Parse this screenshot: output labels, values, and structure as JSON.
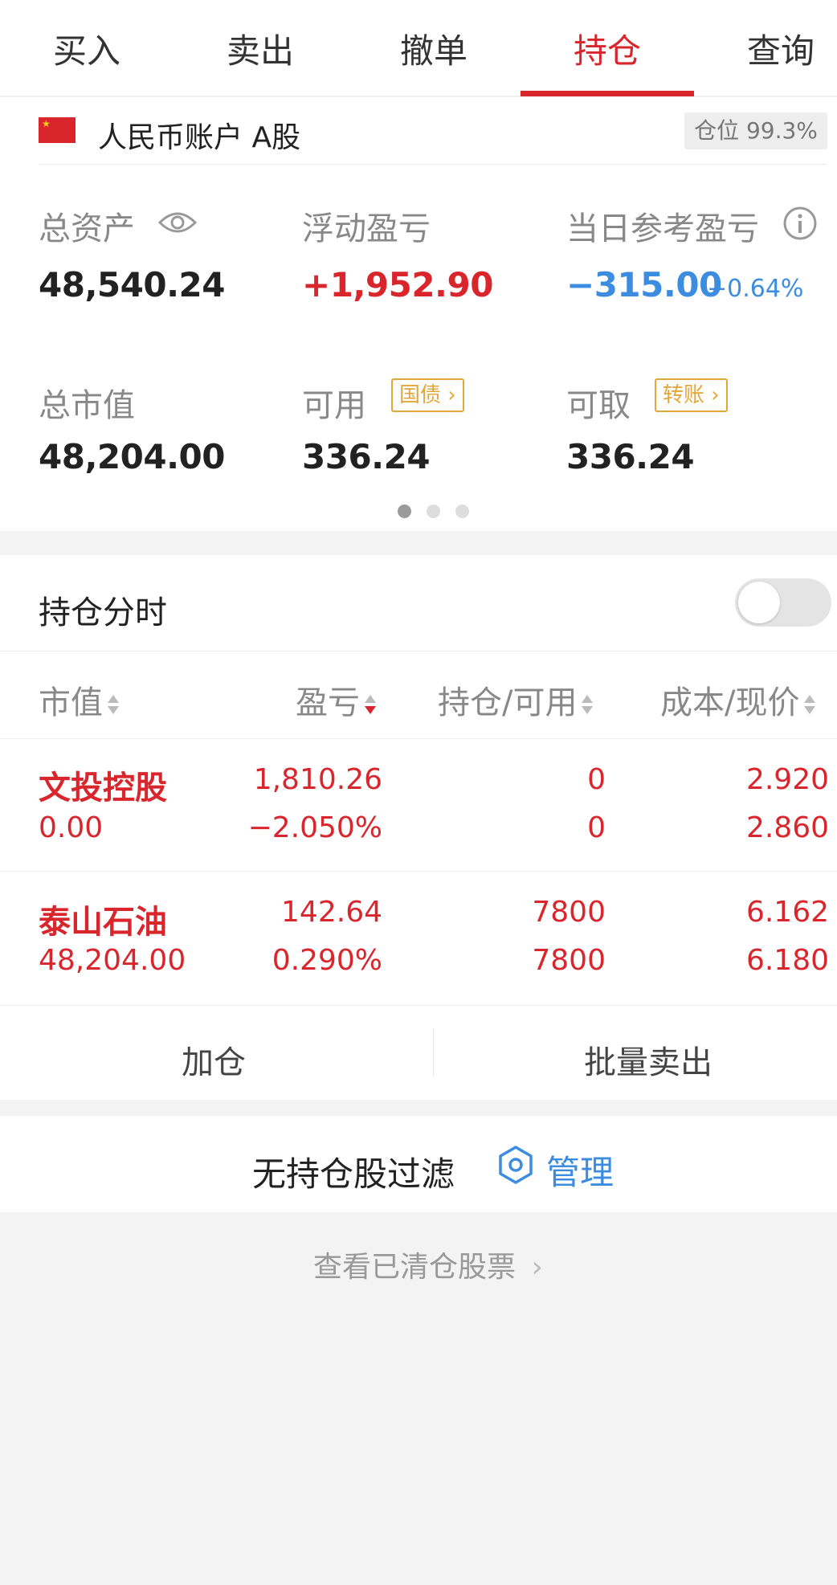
{
  "tabs": [
    {
      "label": "买入"
    },
    {
      "label": "卖出"
    },
    {
      "label": "撤单"
    },
    {
      "label": "持仓",
      "active": true
    },
    {
      "label": "查询"
    }
  ],
  "account": {
    "name": "人民币账户 A股",
    "position_badge": "仓位 99.3%"
  },
  "stats": {
    "total_assets": {
      "label": "总资产",
      "value": "48,540.24"
    },
    "floating_pl": {
      "label": "浮动盈亏",
      "value": "+1,952.90"
    },
    "daily_pl": {
      "label": "当日参考盈亏",
      "value": "−315.00",
      "percent": "−0.64%"
    },
    "market_value": {
      "label": "总市值",
      "value": "48,204.00"
    },
    "available": {
      "label": "可用",
      "tag": "国债",
      "value": "336.24"
    },
    "withdrawable": {
      "label": "可取",
      "tag": "转账",
      "value": "336.24"
    }
  },
  "pager": {
    "count": 3,
    "active": 0
  },
  "holdings_timeshare": {
    "label": "持仓分时",
    "enabled": false
  },
  "columns": [
    {
      "label": "市值"
    },
    {
      "label": "盈亏"
    },
    {
      "label": "持仓/可用"
    },
    {
      "label": "成本/现价"
    }
  ],
  "rows": [
    {
      "name": "文投控股",
      "market_value": "0.00",
      "pl": "1,810.26",
      "pl_pct": "−2.050%",
      "position": "0",
      "available": "0",
      "cost": "2.920",
      "price": "2.860"
    },
    {
      "name": "泰山石油",
      "market_value": "48,204.00",
      "pl": "142.64",
      "pl_pct": "0.290%",
      "position": "7800",
      "available": "7800",
      "cost": "6.162",
      "price": "6.180"
    }
  ],
  "actions": {
    "add": "加仓",
    "batch_sell": "批量卖出"
  },
  "filter": {
    "text": "无持仓股过滤",
    "manage": "管理"
  },
  "cleared_link": "查看已清仓股票",
  "colors": {
    "red": "#d9262d",
    "blue": "#3c8ce0",
    "tag": "#e3a63a"
  }
}
